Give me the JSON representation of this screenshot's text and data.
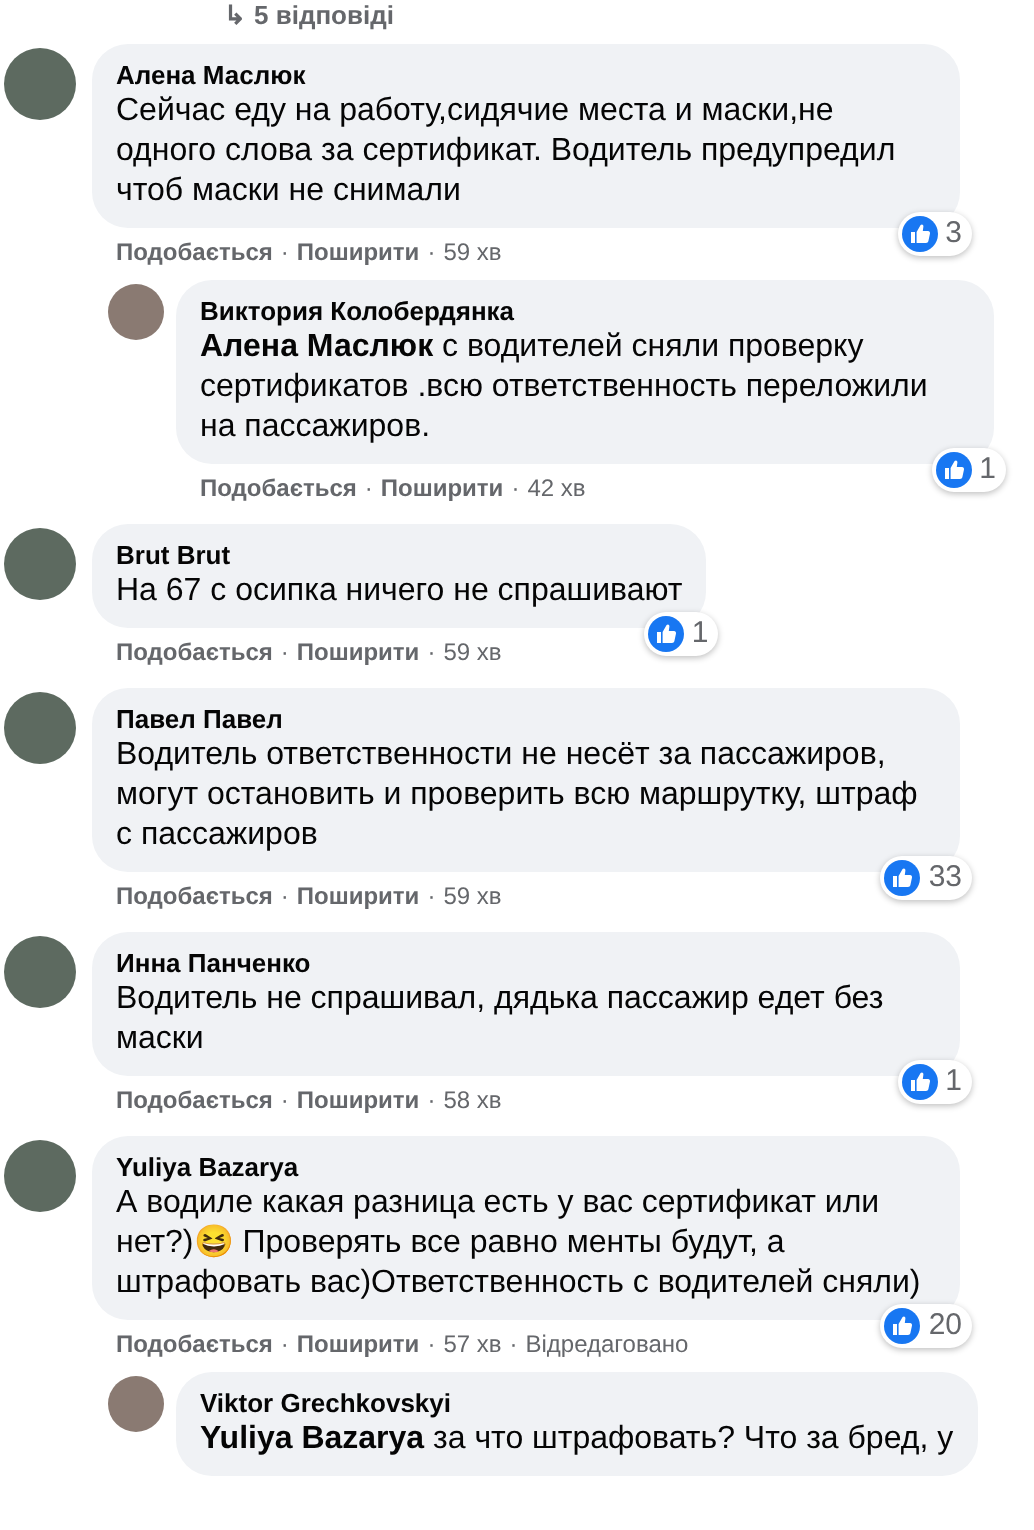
{
  "replies_link": {
    "arrow": "↳",
    "label": "5 відповіді"
  },
  "separator": "·",
  "comments": [
    {
      "author": "Алена Маслюк",
      "text": "Сейчас еду на работу,сидячие места и маски,не одного слова за сертификат. Водитель предупредил чтоб маски не снимали",
      "likes": "3",
      "actions": [
        "Подобається",
        "Поширити"
      ],
      "time": "59 хв",
      "replies": [
        {
          "author": "Виктория Колобердянка",
          "text": "**Алена Маслюк** с водителей сняли проверку сертификатов .всю ответственность переложили на пассажиров.",
          "likes": "1",
          "actions": [
            "Подобається",
            "Поширити"
          ],
          "time": "42 хв"
        }
      ]
    },
    {
      "author": "Brut Brut",
      "text": "На 67 с осипка ничего не спрашивают",
      "likes": "1",
      "actions": [
        "Подобається",
        "Поширити"
      ],
      "time": "59 хв"
    },
    {
      "author": "Павел Павел",
      "text": "Водитель ответственности не несёт за пассажиров, могут остановить и проверить всю маршрутку, штраф с пассажиров",
      "likes": "33",
      "actions": [
        "Подобається",
        "Поширити"
      ],
      "time": "59 хв"
    },
    {
      "author": "Инна Панченко",
      "text": "Водитель не спрашивал, дядька пассажир едет без маски",
      "likes": "1",
      "actions": [
        "Подобається",
        "Поширити"
      ],
      "time": "58 хв"
    },
    {
      "author": "Yuliya Bazarya",
      "text": "А водиле какая разница есть у вас сертификат или нет?)😆 Проверять все равно менты будут, а штрафовать вас)Ответственность с водителей сняли)",
      "likes": "20",
      "actions": [
        "Подобається",
        "Поширити"
      ],
      "time": "57 хв",
      "edited": "Відредаговано",
      "replies": [
        {
          "author": "Viktor Grechkovskyi",
          "text": "**Yuliya Bazarya** за что штрафовать? Что за бред, у"
        }
      ]
    }
  ]
}
